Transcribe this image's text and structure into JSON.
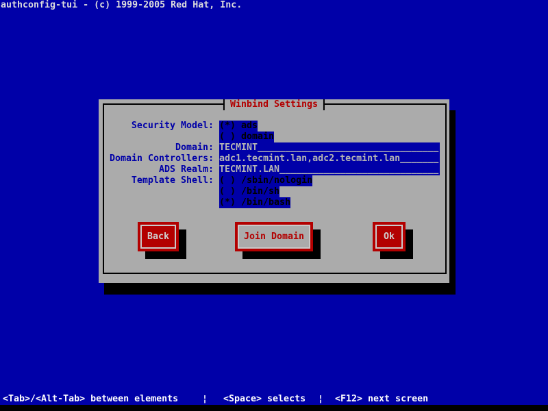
{
  "colors": {
    "background_blue": "#0000a8",
    "dialog_gray": "#ababab",
    "accent_red": "#b30000",
    "shadow_black": "#000000",
    "entry_text_gray": "#b4b4b4",
    "help_text_white": "#ffffff"
  },
  "top_bar": {
    "text": "authconfig-tui - (c) 1999-2005 Red Hat, Inc."
  },
  "dialog": {
    "title": "Winbind Settings",
    "fields": {
      "security_model": {
        "label": "Security Model:",
        "options": [
          "(*) ads",
          "( ) domain"
        ]
      },
      "domain": {
        "label": "Domain:",
        "value": "TECMINT",
        "display": "TECMINT_________________________________"
      },
      "domain_controllers": {
        "label": "Domain Controllers:",
        "value": "adc1.tecmint.lan,adc2.tecmint.lan",
        "display": "adc1.tecmint.lan,adc2.tecmint.lan_______"
      },
      "ads_realm": {
        "label": "ADS Realm:",
        "value": "TECMINT.LAN",
        "display": "TECMINT.LAN_____________________________"
      },
      "template_shell": {
        "label": "Template Shell:",
        "options": [
          "( ) /sbin/nologin",
          "( ) /bin/sh",
          "(*) /bin/bash"
        ]
      }
    },
    "buttons": [
      {
        "label": "Back",
        "active": false
      },
      {
        "label": "Join Domain",
        "active": true
      },
      {
        "label": "Ok",
        "active": false
      }
    ]
  },
  "help_bar": {
    "hint_tab": "<Tab>/<Alt-Tab> between elements",
    "separator": "¦",
    "hint_space": "<Space> selects",
    "hint_f12": "<F12> next screen"
  }
}
